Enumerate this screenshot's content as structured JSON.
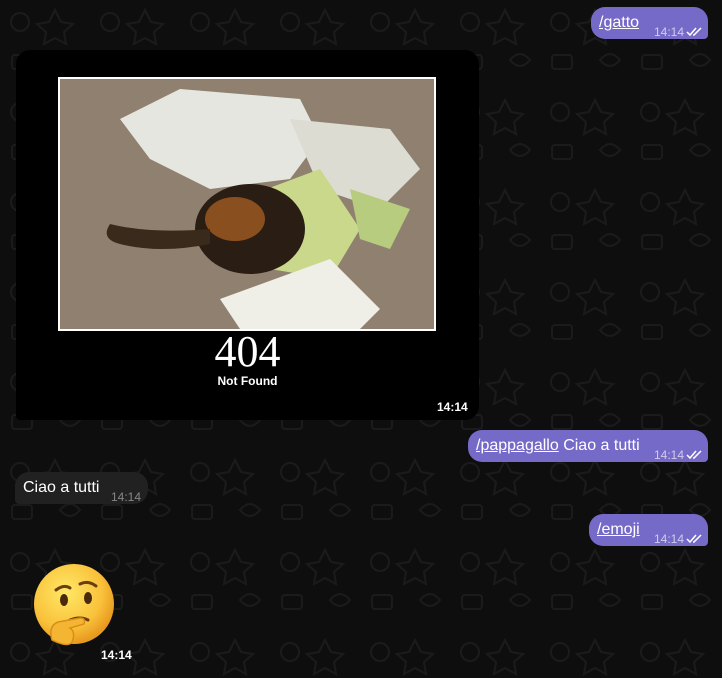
{
  "messages": [
    {
      "type": "outgoing",
      "command": "/gatto",
      "text": "",
      "time": "14:14"
    },
    {
      "type": "incoming-image",
      "caption_big": "404",
      "caption_small": "Not Found",
      "time": "14:14"
    },
    {
      "type": "outgoing",
      "command": "/pappagallo",
      "text": " Ciao a tutti",
      "time": "14:14"
    },
    {
      "type": "incoming",
      "text": "Ciao a tutti",
      "time": "14:14"
    },
    {
      "type": "outgoing",
      "command": "/emoji",
      "text": "",
      "time": "14:14"
    },
    {
      "type": "incoming-sticker",
      "emoji": "🤔",
      "time": "14:14"
    }
  ],
  "colors": {
    "outgoing_bubble": "#766ac8",
    "incoming_bubble": "#212121",
    "background": "#0e0e0e"
  },
  "icons": [
    "double-check-icon",
    "thinking-face-sticker"
  ]
}
